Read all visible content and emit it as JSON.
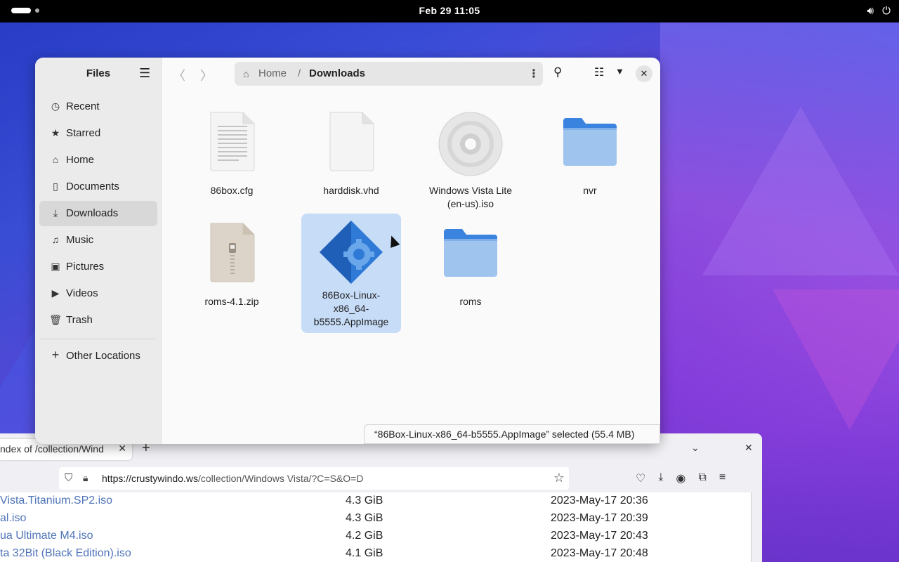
{
  "topbar": {
    "clock": "Feb 29  11:05",
    "icons": [
      "speaker-icon",
      "power-icon"
    ]
  },
  "files": {
    "title": "Files",
    "sidebar": [
      {
        "label": "Recent",
        "icon": "clock-icon"
      },
      {
        "label": "Starred",
        "icon": "star-icon"
      },
      {
        "label": "Home",
        "icon": "home-icon"
      },
      {
        "label": "Documents",
        "icon": "document-icon"
      },
      {
        "label": "Downloads",
        "icon": "download-icon",
        "active": true
      },
      {
        "label": "Music",
        "icon": "music-icon"
      },
      {
        "label": "Pictures",
        "icon": "picture-icon"
      },
      {
        "label": "Videos",
        "icon": "video-icon"
      },
      {
        "label": "Trash",
        "icon": "trash-icon"
      }
    ],
    "other_locations": "Other Locations",
    "path": {
      "home": "Home",
      "separator": "/",
      "current": "Downloads"
    },
    "items": [
      {
        "name": "86box.cfg",
        "type": "text"
      },
      {
        "name": "harddisk.vhd",
        "type": "blank"
      },
      {
        "name": "Windows Vista Lite (en-us).iso",
        "type": "disc"
      },
      {
        "name": "nvr",
        "type": "folder"
      },
      {
        "name": "roms-4.1.zip",
        "type": "zip"
      },
      {
        "name": "86Box-Linux-x86_64-b5555.AppImage",
        "type": "appimage",
        "selected": true
      },
      {
        "name": "roms",
        "type": "folder"
      }
    ],
    "status": "“86Box-Linux-x86_64-b5555.AppImage” selected  (55.4 MB)"
  },
  "browser": {
    "tab_title": "ndex of /collection/Wind",
    "url_host": "https://crustywindo.ws",
    "url_path": "/collection/Windows Vista/?C=S&O=D",
    "rows": [
      {
        "name": "Vista.Titanium.SP2.iso",
        "size": "4.3 GiB",
        "date": "2023-May-17 20:36"
      },
      {
        "name": "al.iso",
        "size": "4.3 GiB",
        "date": "2023-May-17 20:39"
      },
      {
        "name": "ua Ultimate M4.iso",
        "size": "4.2 GiB",
        "date": "2023-May-17 20:43"
      },
      {
        "name": "ta 32Bit (Black Edition).iso",
        "size": "4.1 GiB",
        "date": "2023-May-17 20:48"
      }
    ]
  }
}
